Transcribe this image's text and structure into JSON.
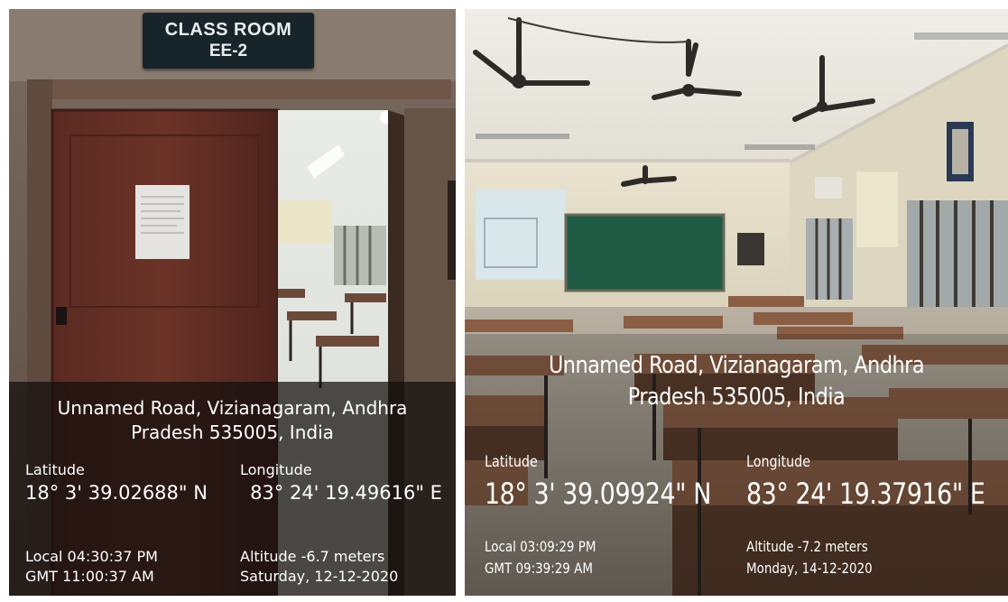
{
  "photos": [
    {
      "sign": {
        "line1": "CLASS ROOM",
        "line2": "EE-2"
      },
      "address": "Unnamed Road, Vizianagaram, Andhra Pradesh 535005, India",
      "latitude_label": "Latitude",
      "latitude_value": "18° 3' 39.02688\" N",
      "longitude_label": "Longitude",
      "longitude_value": "83° 24' 19.49616\" E",
      "local_time": "Local 04:30:37 PM",
      "gmt_time": "GMT 11:00:37 AM",
      "altitude": "Altitude -6.7 meters",
      "date": "Saturday, 12-12-2020"
    },
    {
      "address": "Unnamed Road, Vizianagaram, Andhra Pradesh 535005, India",
      "latitude_label": "Latitude",
      "latitude_value": "18° 3' 39.09924\" N",
      "longitude_label": "Longitude",
      "longitude_value": "83° 24' 19.37916\" E",
      "local_time": "Local 03:09:29 PM",
      "gmt_time": "GMT 09:39:29 AM",
      "altitude": "Altitude -7.2 meters",
      "date": "Monday, 14-12-2020"
    }
  ]
}
